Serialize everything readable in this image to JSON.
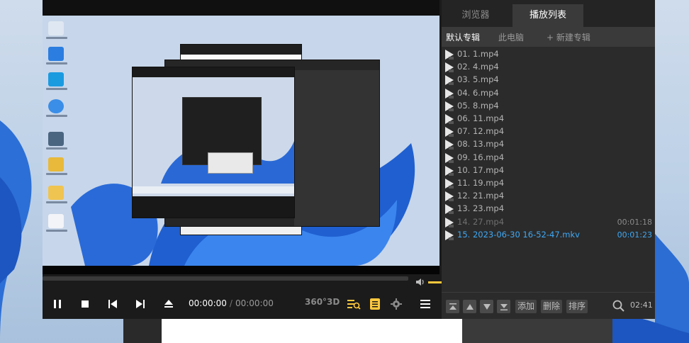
{
  "player": {
    "current_time": "00:00:00",
    "separator": "/",
    "total_time": "00:00:00",
    "volume_level": 0.9,
    "btn_360": "360°",
    "btn_3d": "3D"
  },
  "panel": {
    "tabs": {
      "browse": "浏览器",
      "playlist": "播放列表"
    },
    "subtabs": {
      "default_album": "默认专辑",
      "this_pc": "此电脑",
      "new_album": "+ 新建专辑"
    },
    "items": [
      {
        "label": "01. 1.mp4",
        "duration": ""
      },
      {
        "label": "02. 4.mp4",
        "duration": ""
      },
      {
        "label": "03. 5.mp4",
        "duration": ""
      },
      {
        "label": "04. 6.mp4",
        "duration": ""
      },
      {
        "label": "05. 8.mp4",
        "duration": ""
      },
      {
        "label": "06. 11.mp4",
        "duration": ""
      },
      {
        "label": "07. 12.mp4",
        "duration": ""
      },
      {
        "label": "08. 13.mp4",
        "duration": ""
      },
      {
        "label": "09. 16.mp4",
        "duration": ""
      },
      {
        "label": "10. 17.mp4",
        "duration": ""
      },
      {
        "label": "11. 19.mp4",
        "duration": ""
      },
      {
        "label": "12. 21.mp4",
        "duration": ""
      },
      {
        "label": "13. 23.mp4",
        "duration": ""
      },
      {
        "label": "14. 27.mp4",
        "duration": "00:01:18"
      },
      {
        "label": "15. 2023-06-30 16-52-47.mkv",
        "duration": "00:01:23"
      }
    ],
    "bottom": {
      "add": "添加",
      "delete": "删除",
      "sort": "排序",
      "time": "02:41"
    }
  },
  "colors": {
    "accent_yellow": "#ffc83d",
    "active_blue": "#3fa9f5"
  }
}
